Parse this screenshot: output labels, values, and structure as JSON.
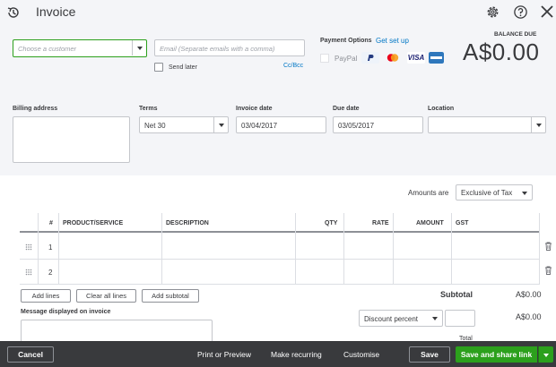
{
  "header": {
    "title": "Invoice",
    "icons": [
      "history-icon",
      "gear-icon",
      "help-icon",
      "close-icon"
    ]
  },
  "customer": {
    "placeholder": "Choose a customer"
  },
  "email": {
    "placeholder": "Email (Separate emails with a comma)"
  },
  "send_later_label": "Send later",
  "cc_bcc": "Cc/Bcc",
  "payment_options": {
    "label": "Payment Options",
    "get_set_up": "Get set up",
    "paypal": "PayPal",
    "visa": "VISA"
  },
  "balance_due": {
    "label": "BALANCE DUE",
    "value": "A$0.00"
  },
  "billing_address_label": "Billing address",
  "terms": {
    "label": "Terms",
    "value": "Net 30"
  },
  "invoice_date": {
    "label": "Invoice date",
    "value": "03/04/2017"
  },
  "due_date": {
    "label": "Due date",
    "value": "03/05/2017"
  },
  "location": {
    "label": "Location",
    "value": ""
  },
  "amounts_are": {
    "label": "Amounts are",
    "value": "Exclusive of Tax"
  },
  "table": {
    "columns": [
      "#",
      "PRODUCT/SERVICE",
      "DESCRIPTION",
      "QTY",
      "RATE",
      "AMOUNT",
      "GST"
    ],
    "rows": [
      {
        "num": "1"
      },
      {
        "num": "2"
      }
    ]
  },
  "table_buttons": {
    "add_lines": "Add lines",
    "clear_all_lines": "Clear all lines",
    "add_subtotal": "Add subtotal"
  },
  "subtotal": {
    "label": "Subtotal",
    "value": "A$0.00"
  },
  "message_label": "Message displayed on invoice",
  "discount": {
    "type": "Discount percent",
    "value": "A$0.00"
  },
  "total_label": "Total",
  "footer": {
    "cancel": "Cancel",
    "print_preview": "Print or Preview",
    "make_recurring": "Make recurring",
    "customise": "Customise",
    "save": "Save",
    "save_share": "Save and share link"
  },
  "colors": {
    "accent_green": "#2ca01c",
    "link_blue": "#0077c5",
    "footer_bg": "#393a3d"
  }
}
